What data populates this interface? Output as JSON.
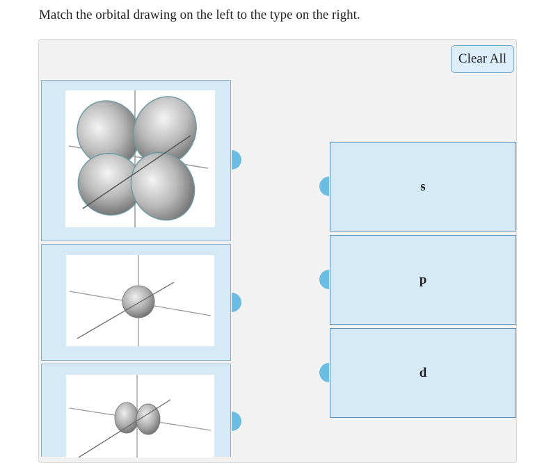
{
  "instructions": "Match the orbital drawing on the left to the type on the right.",
  "clear_all_label": "Clear All",
  "drawings": [
    {
      "icon": "d-orbital-cloverleaf-icon"
    },
    {
      "icon": "s-orbital-sphere-icon"
    },
    {
      "icon": "p-orbital-dumbbell-icon"
    }
  ],
  "targets": [
    {
      "label": "s"
    },
    {
      "label": "p"
    },
    {
      "label": "d"
    }
  ],
  "colors": {
    "card_bg": "#d6e9f6",
    "handle": "#6bbde4",
    "panel_bg": "#f2f2f2"
  }
}
